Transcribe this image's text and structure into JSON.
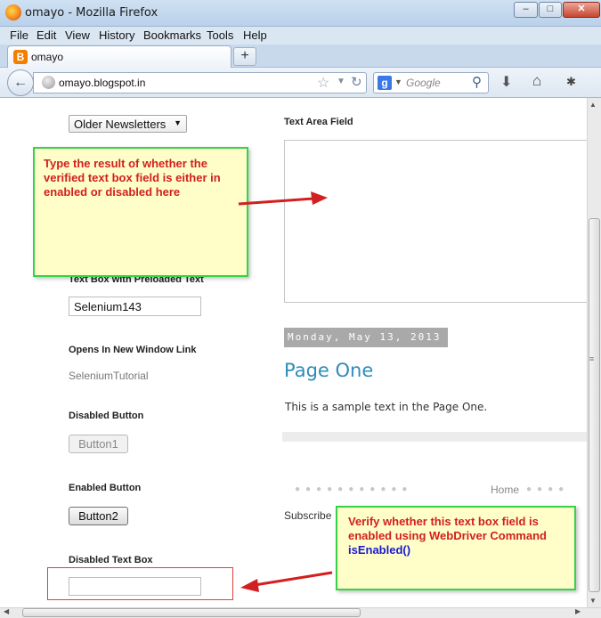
{
  "window": {
    "title": "omayo - Mozilla Firefox",
    "minimize": "–",
    "maximize": "□",
    "close": "✕"
  },
  "menu": [
    "File",
    "Edit",
    "View",
    "History",
    "Bookmarks",
    "Tools",
    "Help"
  ],
  "tab": {
    "title": "omayo",
    "new_tab": "+"
  },
  "nav": {
    "url": "omayo.blogspot.in",
    "search_placeholder": "Google",
    "back_icon": "←",
    "search_engine_letter": "g"
  },
  "page": {
    "select_value": "Older Newsletters",
    "text_area_label": "Text Area Field",
    "preloaded_label": "Text Box with Preloaded Text",
    "preloaded_value": "Selenium143",
    "new_window_label": "Opens In New Window Link",
    "new_window_link": "SeleniumTutorial",
    "disabled_button_label": "Disabled Button",
    "disabled_button": "Button1",
    "enabled_button_label": "Enabled Button",
    "enabled_button": "Button2",
    "disabled_textbox_label": "Disabled Text Box",
    "date": "Monday, May 13, 2013",
    "post_title": "Page One",
    "post_body": "This is a sample text in the Page One.",
    "home_link": "Home",
    "subscribe": "Subscribe"
  },
  "callouts": {
    "top": "Type the result of whether the verified text box field is either in enabled or disabled here",
    "bottom_line1": "Verify whether this text box field is enabled using WebDriver Command",
    "bottom_line2": "isEnabled()"
  },
  "colors": {
    "callout_border": "#35d24a",
    "callout_fill": "#fffdc8",
    "callout_text": "#d21f1f",
    "command_text": "#1a1ad2",
    "arrow": "#d21f1f",
    "link_blue": "#2f8cb8"
  }
}
